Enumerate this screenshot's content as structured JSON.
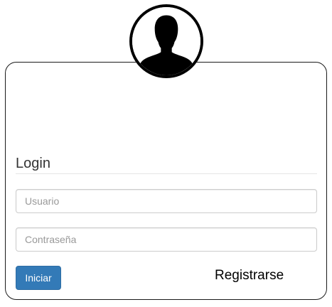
{
  "avatar": {
    "icon": "user-silhouette-icon"
  },
  "form": {
    "title": "Login",
    "username_placeholder": "Usuario",
    "username_value": "",
    "password_placeholder": "Contraseña",
    "password_value": "",
    "submit_label": "Iniciar",
    "register_label": "Registrarse"
  },
  "colors": {
    "primary_button": "#337ab7",
    "card_border": "#1a1a1a",
    "avatar_ring": "#000000"
  }
}
